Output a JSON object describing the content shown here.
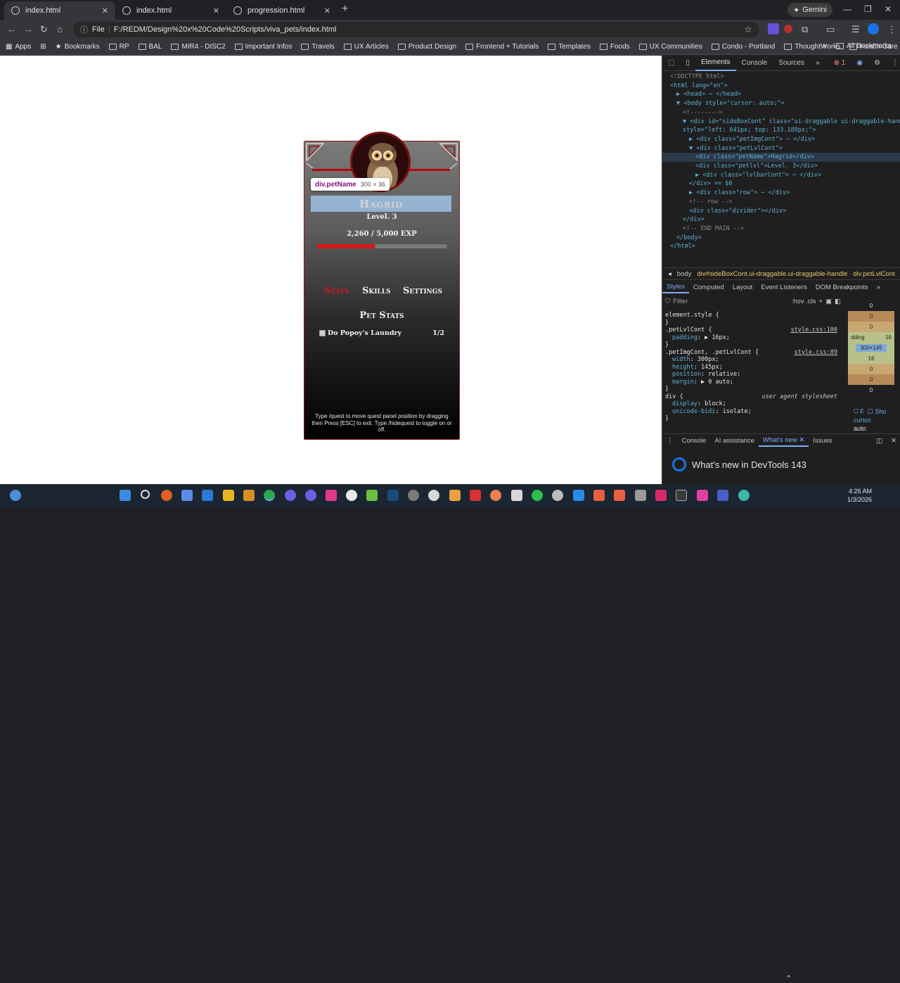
{
  "browser": {
    "tabs": [
      {
        "label": "index.html",
        "active": true
      },
      {
        "label": "index.html",
        "active": false
      },
      {
        "label": "progression.html",
        "active": false
      }
    ],
    "gemini_label": "Gemini",
    "address_chip": "File",
    "url": "F:/REDM/Design%20x%20Code%20Scripts/viva_pets/index.html",
    "bookmarks": [
      "Apps",
      "Bookmarks",
      "RP",
      "BAL",
      "MIR4 - DISC2",
      "Important Infos",
      "Travels",
      "UX Articles",
      "Product Design",
      "Frontend + Tutorials",
      "Templates",
      "Foods",
      "UX Communities",
      "Condo - Portland",
      "ThoughtWorks",
      "Health Care"
    ],
    "all_bookmarks": "All Bookmarks",
    "accent": "#7cacf8"
  },
  "page": {
    "tooltip": {
      "name": "div.petName",
      "size": "300 × 36"
    },
    "pet_name": "Hagrid",
    "pet_level": "Level. 3",
    "exp_text": "2,260 / 5,000 EXP",
    "exp_fraction": 0.452,
    "nav_tabs": [
      {
        "label": "Stats",
        "active": true
      },
      {
        "label": "Skills",
        "active": false
      },
      {
        "label": "Settings",
        "active": false
      }
    ],
    "stats_title": "Pet Stats",
    "quest": {
      "name": "Do Popoy's Laundry",
      "progress": "1/2"
    },
    "hint": "Type /quest to move quest panel position by dragging then Press [ESC] to exit. Type /hidequest to toggle on or off.",
    "accent_red": "#d11a1a"
  },
  "devtools": {
    "tabs": [
      "Elements",
      "Console",
      "Sources"
    ],
    "error_count": "1",
    "dom_lines": [
      {
        "indent": 1,
        "html": "<!DOCTYPE html>",
        "kind": "cmt"
      },
      {
        "indent": 1,
        "tag": "html",
        "attrs": "lang=\"en\"",
        "open": true
      },
      {
        "indent": 2,
        "raw": "▶ <head> ⋯ </head>"
      },
      {
        "indent": 2,
        "raw": "▼ <body style=\"cursor: auto;\">"
      },
      {
        "indent": 3,
        "raw": "<!-------->",
        "kind": "cmt"
      },
      {
        "indent": 3,
        "raw": "▼ <div id=\"sideBoxCont\" class=\"ui-draggable ui-draggable-handle\""
      },
      {
        "indent": 3,
        "raw": "style=\"left: 641px; top: 133.188px;\">"
      },
      {
        "indent": 4,
        "raw": "▶ <div class=\"petImgCont\"> ⋯ </div>"
      },
      {
        "indent": 4,
        "raw": "▼ <div class=\"petLvlCont\">"
      },
      {
        "indent": 5,
        "raw": "<div class=\"petName\">Hagrid</div>",
        "sel": true
      },
      {
        "indent": 5,
        "raw": "<div class=\"petlvl\">Level. 3</div>"
      },
      {
        "indent": 5,
        "raw": "▶ <div class=\"lvlbarCont\"> ⋯ </div>"
      },
      {
        "indent": 4,
        "raw": "</div> == $0"
      },
      {
        "indent": 4,
        "raw": "▶ <div class=\"row\"> ⋯ </div>"
      },
      {
        "indent": 4,
        "raw": "<!-- row -->",
        "kind": "cmt"
      },
      {
        "indent": 4,
        "raw": "<div class=\"divider\"></div>"
      },
      {
        "indent": 3,
        "raw": "</div>"
      },
      {
        "indent": 3,
        "raw": "<!-- END MAIN -->",
        "kind": "cmt"
      },
      {
        "indent": 2,
        "raw": "</body>"
      },
      {
        "indent": 1,
        "raw": "</html>"
      }
    ],
    "breadcrumbs": [
      "body",
      "div#sideBoxCont.ui-draggable.ui-draggable-handle",
      "div.petLvlCont"
    ],
    "subtabs": [
      "Styles",
      "Computed",
      "Layout",
      "Event Listeners",
      "DOM Breakpoints"
    ],
    "filter_placeholder": "Filter",
    "filter_right": ":hov  .cls",
    "style_rules": [
      {
        "selector": "element.style {",
        "source": ""
      },
      {
        "selector": "}",
        "source": ""
      },
      {
        "selector": ".petLvlCont {",
        "source": "style.css:100"
      },
      {
        "prop": "padding",
        "val": "▶ 16px;"
      },
      {
        "selector": "}",
        "source": ""
      },
      {
        "selector": ".petImgCont, .petLvlCont {",
        "source": "style.css:89"
      },
      {
        "prop": "width",
        "val": "300px;"
      },
      {
        "prop": "height",
        "val": "145px;"
      },
      {
        "prop": "position",
        "val": "relative;"
      },
      {
        "prop": "margin",
        "val": "▶ 0 auto;"
      },
      {
        "selector": "}",
        "source": ""
      },
      {
        "selector": "div {",
        "source": "user agent stylesheet"
      },
      {
        "prop": "display",
        "val": "block;"
      },
      {
        "prop": "unicode-bidi",
        "val": "isolate;"
      },
      {
        "selector": "}",
        "source": ""
      }
    ],
    "box_model": [
      "0",
      "0",
      "0",
      "16",
      "300×145",
      "16",
      "0",
      "0",
      "0"
    ],
    "box_padding_label": "dding",
    "computed_filter": "cursor",
    "computed_val": "auto",
    "drawer_tabs": [
      "Console",
      "AI assistance",
      "What's new",
      "Issues"
    ],
    "whats_new": "What's new in DevTools 143"
  },
  "taskbar": {
    "time": "4:26 AM",
    "date": "1/3/2026"
  }
}
